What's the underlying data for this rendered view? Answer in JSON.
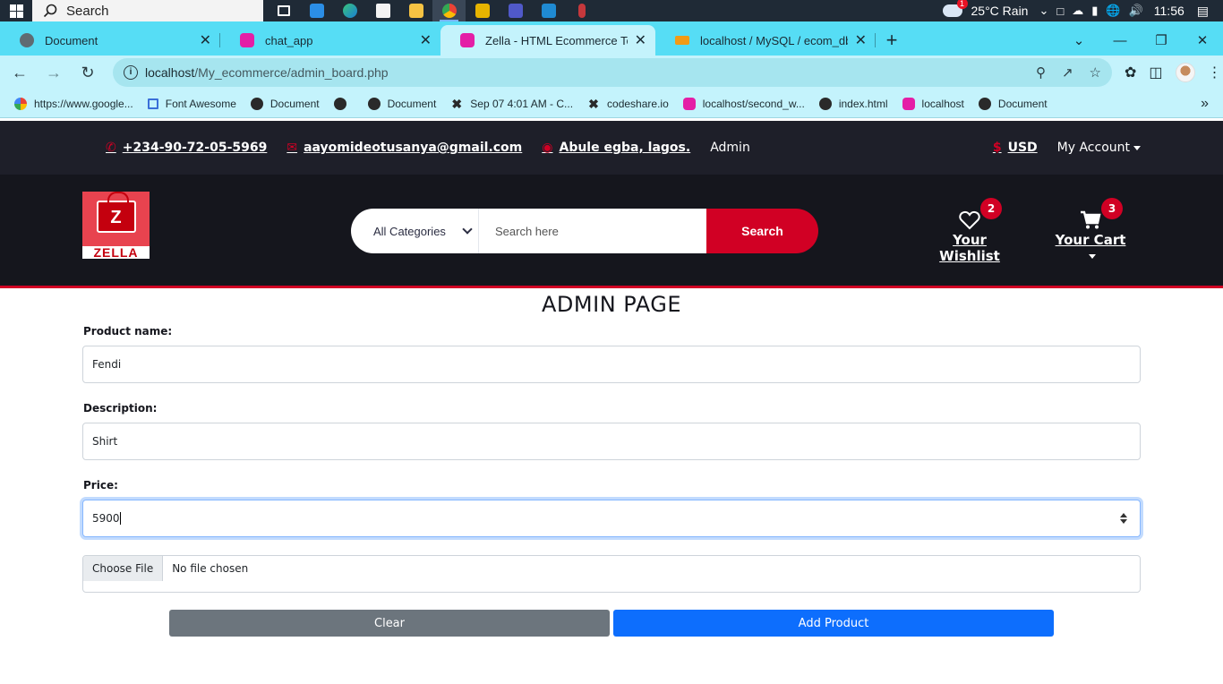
{
  "taskbar": {
    "search_label": "Search",
    "weather_badge": "1",
    "weather": "25°C  Rain",
    "time": "11:56"
  },
  "tabs": [
    {
      "title": "Document",
      "icon": "globe-icon"
    },
    {
      "title": "chat_app",
      "icon": "webstack-icon"
    },
    {
      "title": "Zella - HTML Ecommerce Templa",
      "icon": "webstack-icon"
    },
    {
      "title": "localhost / MySQL / ecom_db / p",
      "icon": "phpmyadmin-icon"
    }
  ],
  "address": {
    "host": "localhost",
    "path": "/My_ecommerce/admin_board.php"
  },
  "bookmarks": [
    {
      "label": "https://www.google...",
      "icon": "google-icon"
    },
    {
      "label": "Font Awesome",
      "icon": "flag-icon"
    },
    {
      "label": "Document",
      "icon": "globe-icon"
    },
    {
      "label": "",
      "icon": "globe-icon"
    },
    {
      "label": "Document",
      "icon": "globe-icon"
    },
    {
      "label": "Sep 07 4:01 AM - C...",
      "icon": "codeshare-icon"
    },
    {
      "label": "codeshare.io",
      "icon": "codeshare-icon"
    },
    {
      "label": "localhost/second_w...",
      "icon": "webstack-icon"
    },
    {
      "label": "index.html",
      "icon": "globe-icon"
    },
    {
      "label": "localhost",
      "icon": "webstack-icon"
    },
    {
      "label": "Document",
      "icon": "globe-icon"
    }
  ],
  "header_top": {
    "phone": "+234-90-72-05-5969",
    "email": "aayomideotusanya@gmail.com",
    "address": "Abule egba, lagos.",
    "admin": "Admin",
    "currency": "USD",
    "account": "My Account"
  },
  "header_main": {
    "logo_text": "ZELLA",
    "logo_letter": "Z",
    "category": "All Categories",
    "search_placeholder": "Search here",
    "search_button": "Search",
    "wishlist_label": "Your Wishlist",
    "wishlist_count": "2",
    "cart_label": "Your Cart",
    "cart_count": "3"
  },
  "admin_form": {
    "title": "ADMIN PAGE",
    "product_name_label": "Product name:",
    "product_name_value": "Fendi",
    "description_label": "Description:",
    "description_value": "Shirt",
    "price_label": "Price:",
    "price_value": "5900",
    "file_button": "Choose File",
    "file_status": "No file chosen",
    "clear_button": "Clear",
    "add_button": "Add Product"
  },
  "colors": {
    "brand_red": "#D10024",
    "header_dark": "#15161D",
    "header_top": "#1E1F29",
    "tab_strip": "#56DDF5",
    "primary_blue": "#0D6EFD",
    "secondary_gray": "#6C757D"
  }
}
